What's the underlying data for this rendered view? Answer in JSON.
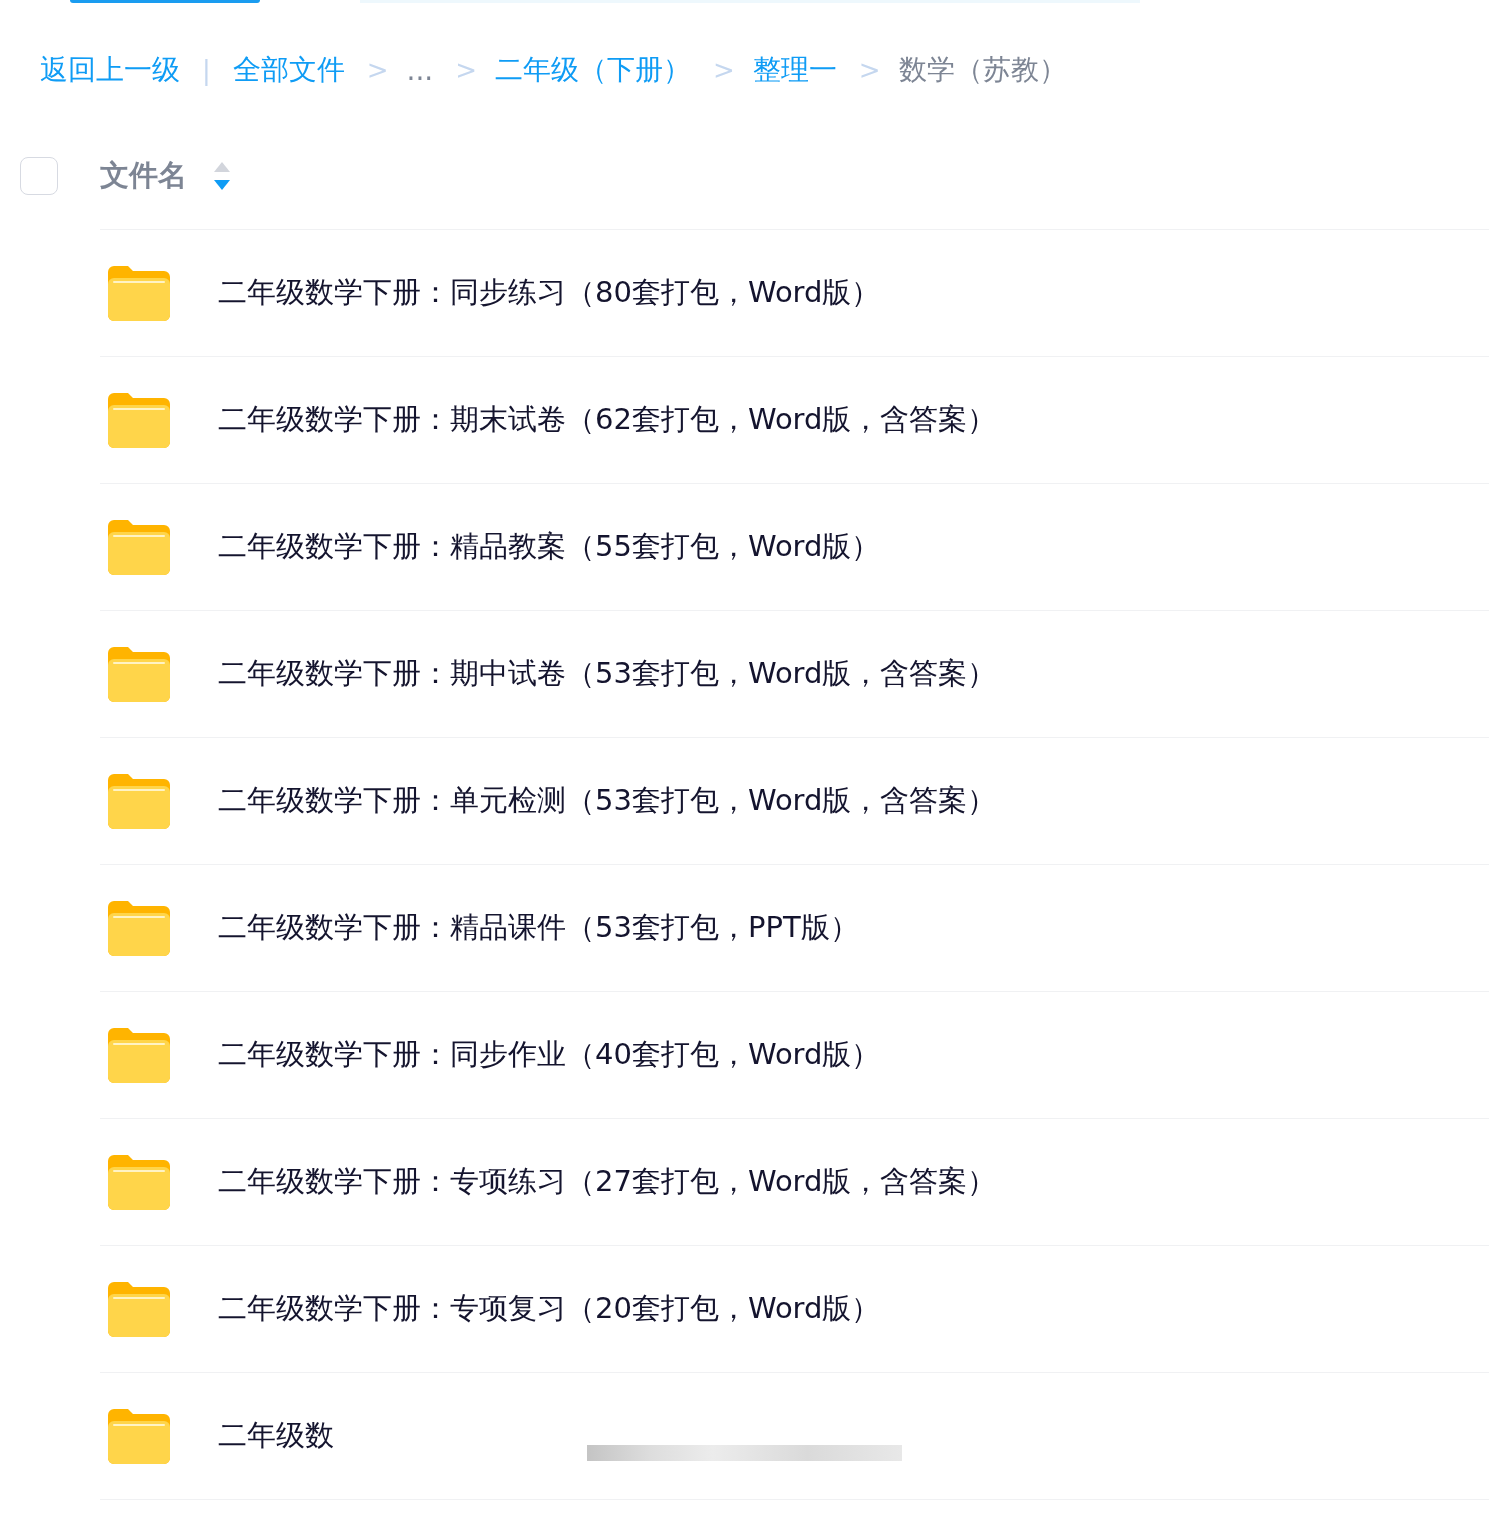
{
  "breadcrumb": {
    "back": "返回上一级",
    "divider": "|",
    "items": [
      {
        "label": "全部文件",
        "kind": "link",
        "separator": ">"
      },
      {
        "label": "...",
        "kind": "ellipsis",
        "separator": ">"
      },
      {
        "label": "二年级（下册）",
        "kind": "link",
        "separator": ">"
      },
      {
        "label": "整理一",
        "kind": "link",
        "separator": ">"
      },
      {
        "label": "数学（苏教）",
        "kind": "current"
      }
    ]
  },
  "header": {
    "select_all": {
      "checked": false
    },
    "column": "文件名",
    "sort_descending": true
  },
  "rows": [
    {
      "name": "二年级数学下册：同步练习（80套打包，Word版）"
    },
    {
      "name": "二年级数学下册：期末试卷（62套打包，Word版，含答案）"
    },
    {
      "name": "二年级数学下册：精品教案（55套打包，Word版）"
    },
    {
      "name": "二年级数学下册：期中试卷（53套打包，Word版，含答案）"
    },
    {
      "name": "二年级数学下册：单元检测（53套打包，Word版，含答案）"
    },
    {
      "name": "二年级数学下册：精品课件（53套打包，PPT版）"
    },
    {
      "name": "二年级数学下册：同步作业（40套打包，Word版）"
    },
    {
      "name": "二年级数学下册：专项练习（27套打包，Word版，含答案）"
    },
    {
      "name": "二年级数学下册：专项复习（20套打包，Word版）"
    },
    {
      "name": "二年级数",
      "redacted": true
    }
  ]
}
